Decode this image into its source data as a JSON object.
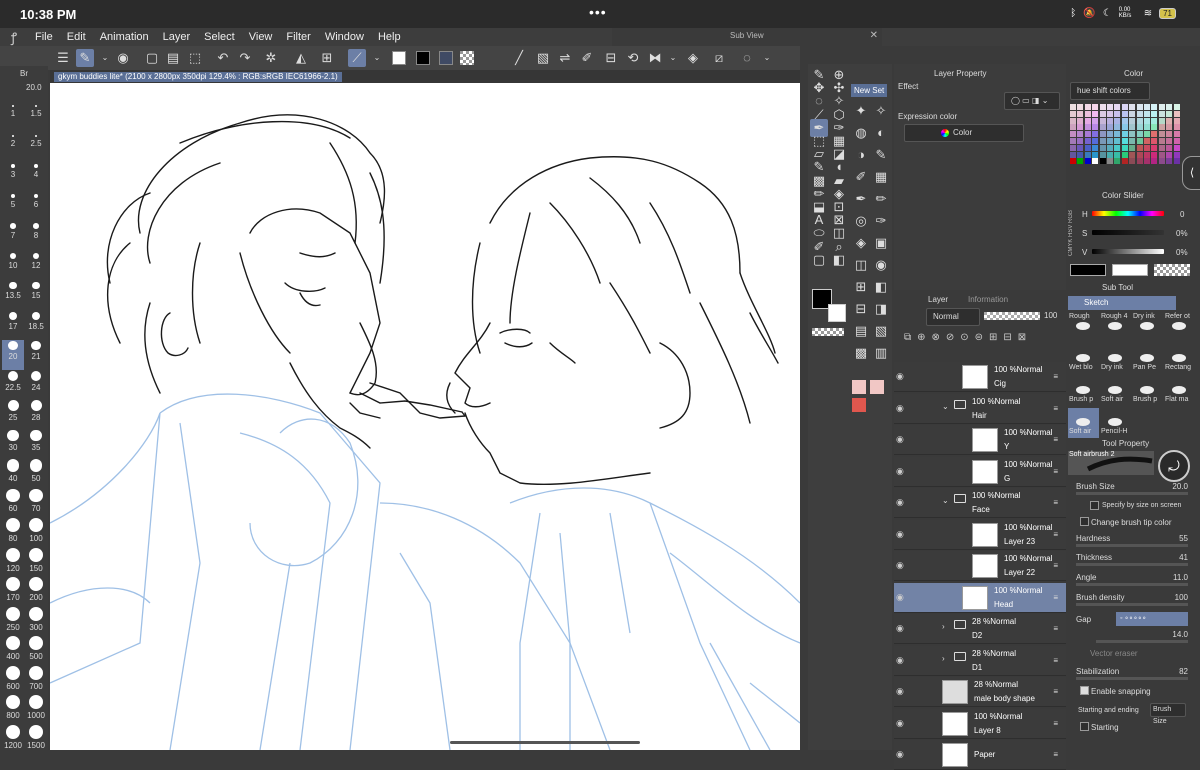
{
  "status": {
    "time": "10:38 PM",
    "dots": "•••",
    "net": "0.00 KB/s",
    "battery": "71"
  },
  "menu": {
    "items": [
      "File",
      "Edit",
      "Animation",
      "Layer",
      "Select",
      "View",
      "Filter",
      "Window",
      "Help"
    ]
  },
  "subview": {
    "title": "Sub View",
    "close": "✕"
  },
  "brush_size_panel": {
    "tab": "Br",
    "current": "20.0",
    "sizes": [
      "1",
      "1.5",
      "2",
      "2.5",
      "3",
      "4",
      "5",
      "6",
      "7",
      "8",
      "10",
      "12",
      "13.5",
      "15",
      "17",
      "18.5",
      "20",
      "21",
      "22.5",
      "24",
      "25",
      "28",
      "30",
      "35",
      "40",
      "50",
      "60",
      "70",
      "80",
      "100",
      "120",
      "150",
      "170",
      "200",
      "250",
      "300",
      "400",
      "500",
      "600",
      "700",
      "800",
      "1000",
      "1200",
      "1500"
    ],
    "selected": "20"
  },
  "document": {
    "tab_label": "gkym buddies lite* (2100 x 2800px 350dpi 129.4% : RGB:sRGB IEC61966-2.1)"
  },
  "tool_palette": {
    "new_set": "New Set"
  },
  "layer_property": {
    "title": "Layer Property",
    "effect_label": "Effect",
    "expression_label": "Expression color",
    "expression_value": "Color"
  },
  "layer_panel": {
    "tab_layer": "Layer",
    "tab_info": "Information",
    "blend_mode": "Normal",
    "opacity": "100",
    "layers": [
      {
        "mode": "100 %Normal",
        "name": "Cig",
        "indent": 2,
        "type": "raster",
        "selected": false
      },
      {
        "mode": "100 %Normal",
        "name": "Hair",
        "indent": 1,
        "type": "folder",
        "selected": false
      },
      {
        "mode": "100 %Normal",
        "name": "Y",
        "indent": 3,
        "type": "raster",
        "selected": false
      },
      {
        "mode": "100 %Normal",
        "name": "G",
        "indent": 3,
        "type": "raster",
        "selected": false
      },
      {
        "mode": "100 %Normal",
        "name": "Face",
        "indent": 1,
        "type": "folder",
        "selected": false
      },
      {
        "mode": "100 %Normal",
        "name": "Layer 23",
        "indent": 3,
        "type": "raster",
        "selected": false
      },
      {
        "mode": "100 %Normal",
        "name": "Layer 22",
        "indent": 3,
        "type": "raster",
        "selected": false
      },
      {
        "mode": "100 %Normal",
        "name": "Head",
        "indent": 2,
        "type": "raster",
        "selected": true
      },
      {
        "mode": "28 %Normal",
        "name": "D2",
        "indent": 1,
        "type": "folder",
        "selected": false
      },
      {
        "mode": "28 %Normal",
        "name": "D1",
        "indent": 1,
        "type": "folder",
        "selected": false
      },
      {
        "mode": "28 %Normal",
        "name": "male body shape",
        "indent": 0,
        "type": "reference",
        "selected": false
      },
      {
        "mode": "100 %Normal",
        "name": "Layer 8",
        "indent": 0,
        "type": "raster",
        "selected": false
      },
      {
        "mode": "",
        "name": "Paper",
        "indent": 0,
        "type": "paper",
        "selected": false
      }
    ]
  },
  "color_panel": {
    "title": "Color",
    "set_name": "hue shift colors"
  },
  "color_slider": {
    "title": "Color Slider",
    "modes": "CMYK HSV RGB",
    "h_label": "H",
    "h_value": "0",
    "s_label": "S",
    "s_value": "0%",
    "v_label": "V",
    "v_value": "0%"
  },
  "sub_tool": {
    "title": "Sub Tool",
    "group": "Sketch",
    "brushes": [
      "Rough",
      "Rough 4",
      "Dry ink",
      "Refer ot",
      "Wet blo",
      "Dry ink",
      "Pan Pe",
      "Rectang",
      "Brush p",
      "Soft air",
      "Brush p",
      "Flat ma",
      "Soft air",
      "Pencil-H"
    ]
  },
  "tool_property": {
    "title": "Tool Property",
    "brush_name": "Soft airbrush 2",
    "brush_size_label": "Brush Size",
    "brush_size_value": "20.0",
    "size_by_screen": "Specify by size on screen",
    "change_tip_color": "Change brush tip color",
    "hardness_label": "Hardness",
    "hardness_value": "55",
    "thickness_label": "Thickness",
    "thickness_value": "41",
    "angle_label": "Angle",
    "angle_value": "11.0",
    "density_label": "Brush density",
    "density_value": "100",
    "gap_label": "Gap",
    "gap_value": "14.0",
    "vector_eraser": "Vector eraser",
    "stabilization_label": "Stabilization",
    "stabilization_value": "82",
    "enable_snapping": "Enable snapping",
    "start_end_label": "Starting and ending",
    "start_end_value": "Brush Size",
    "starting": "Starting"
  },
  "colors": {
    "accent": "#6c7fa6",
    "canvas_bg": "#ffffff",
    "line_dark": "#1a1a1a",
    "line_blue": "#9fc0e6"
  }
}
